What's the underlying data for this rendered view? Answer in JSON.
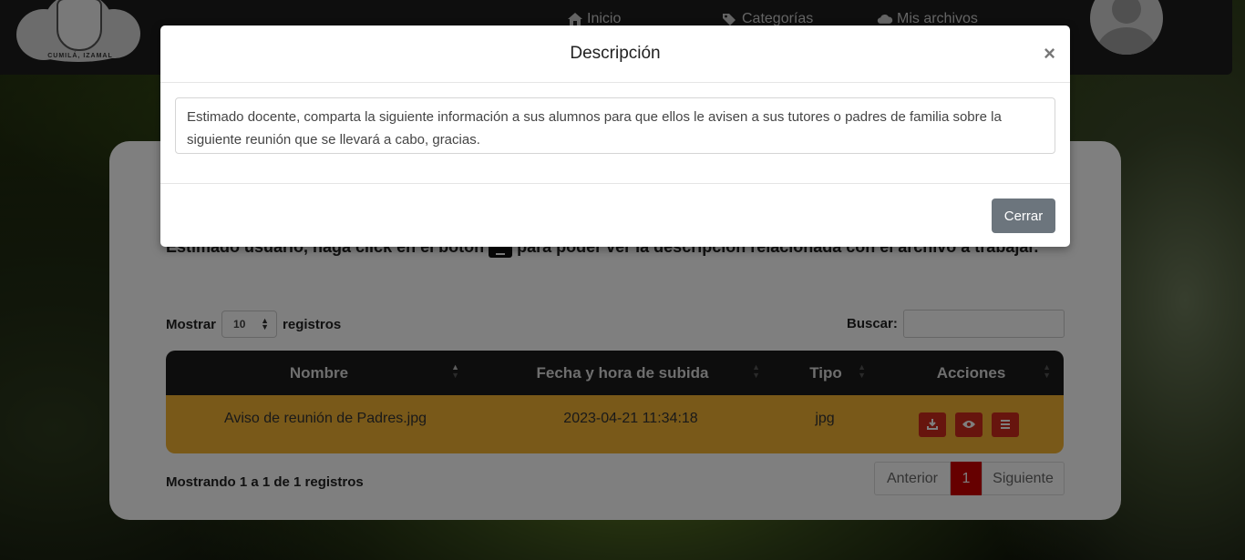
{
  "navbar": {
    "logo_text": "CUMILÁ, IZAMAL",
    "links": [
      {
        "label": "Inicio",
        "icon": "home-icon"
      },
      {
        "label": "Categorías",
        "icon": "tags-icon"
      },
      {
        "label": "Mis archivos",
        "icon": "cloud-icon"
      }
    ],
    "avatar_icon": "user-icon"
  },
  "main": {
    "instructions_before": "Estimado usuario, haga click en el botón",
    "instructions_after": "para poder ver la descripción relacionada con el archivo a trabajar.",
    "length_prefix": "Mostrar",
    "length_value": "10",
    "length_suffix": "registros",
    "search_label": "Buscar:",
    "search_value": "",
    "table": {
      "headers": [
        "Nombre",
        "Fecha y hora de subida",
        "Tipo",
        "Acciones"
      ],
      "rows": [
        {
          "nombre": "Aviso de reunión de Padres.jpg",
          "fecha": "2023-04-21 11:34:18",
          "tipo": "jpg"
        }
      ],
      "action_icons": [
        "download-icon",
        "eye-icon",
        "list-icon"
      ]
    },
    "info": "Mostrando 1 a 1 de 1 registros",
    "pagination": {
      "prev": "Anterior",
      "current": "1",
      "next": "Siguiente"
    }
  },
  "modal": {
    "title": "Descripción",
    "close_symbol": "×",
    "description": "Estimado docente, comparta la siguiente información a sus alumnos para que ellos le avisen a sus tutores o padres de familia sobre la siguiente reunión que se llevará a cabo, gracias.",
    "close_button": "Cerrar"
  },
  "colors": {
    "row_highlight": "#f2b233",
    "action_button": "#cf2a1d",
    "current_page": "#cc0000",
    "close_button": "#6c757d"
  }
}
